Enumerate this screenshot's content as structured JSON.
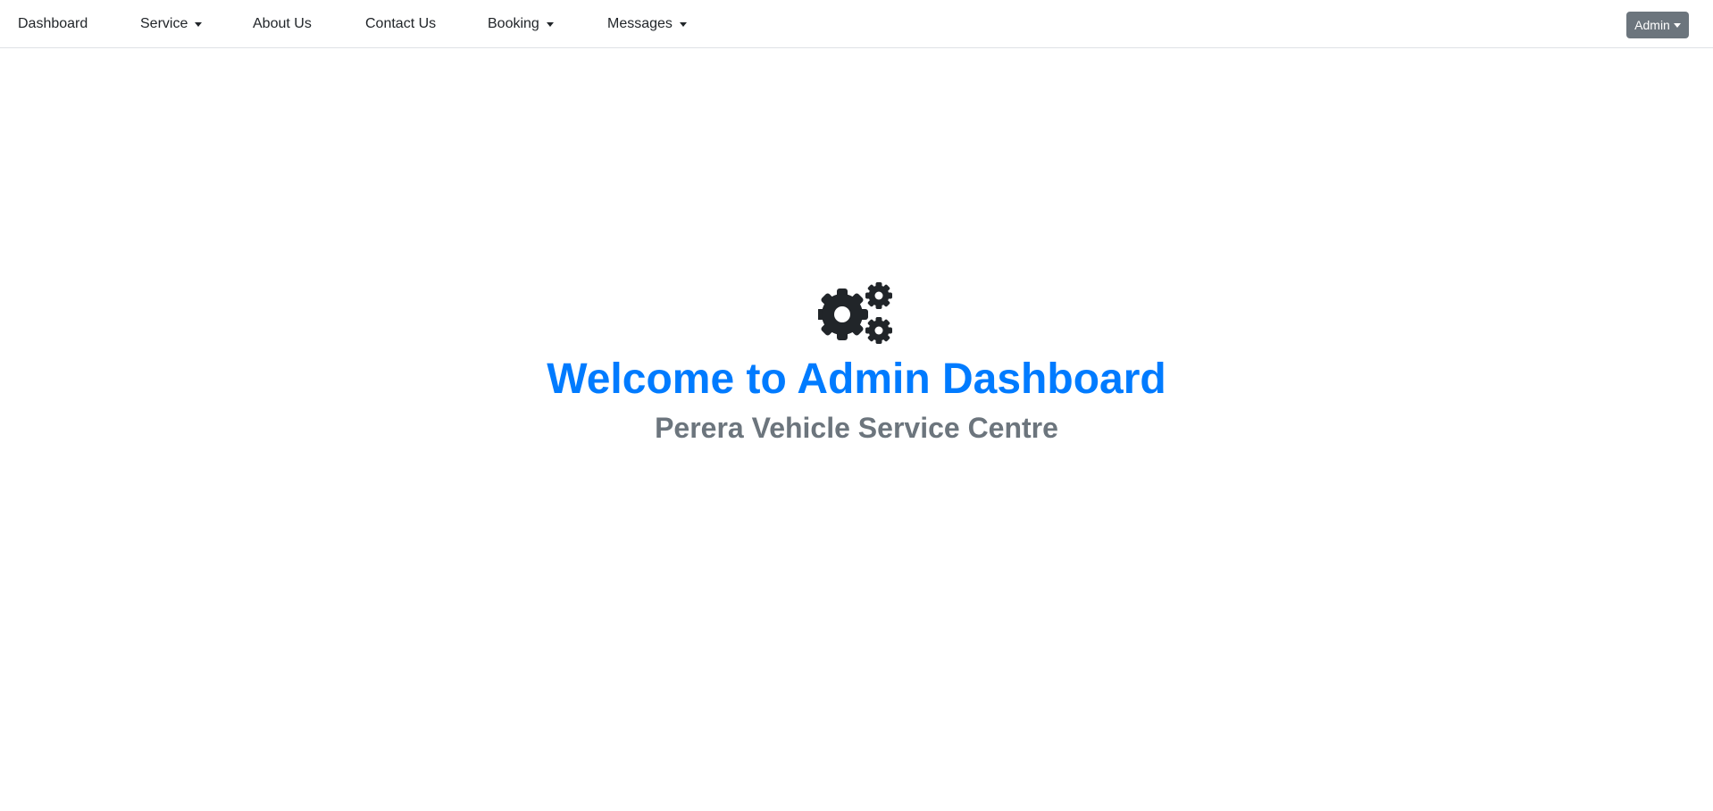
{
  "navbar": {
    "items": [
      {
        "label": "Dashboard",
        "dropdown": false
      },
      {
        "label": "Service",
        "dropdown": true
      },
      {
        "label": "About Us",
        "dropdown": false
      },
      {
        "label": "Contact Us",
        "dropdown": false
      },
      {
        "label": "Booking",
        "dropdown": true
      },
      {
        "label": "Messages",
        "dropdown": true
      }
    ],
    "user_menu": {
      "label": "Admin",
      "dropdown": true
    }
  },
  "hero": {
    "icon": "gears-icon",
    "title": "Welcome to Admin Dashboard",
    "subtitle": "Perera Vehicle Service Centre"
  },
  "colors": {
    "title": "#007bff",
    "subtitle": "#6c757d",
    "admin_button": "#6c757d",
    "icon": "#212529"
  }
}
